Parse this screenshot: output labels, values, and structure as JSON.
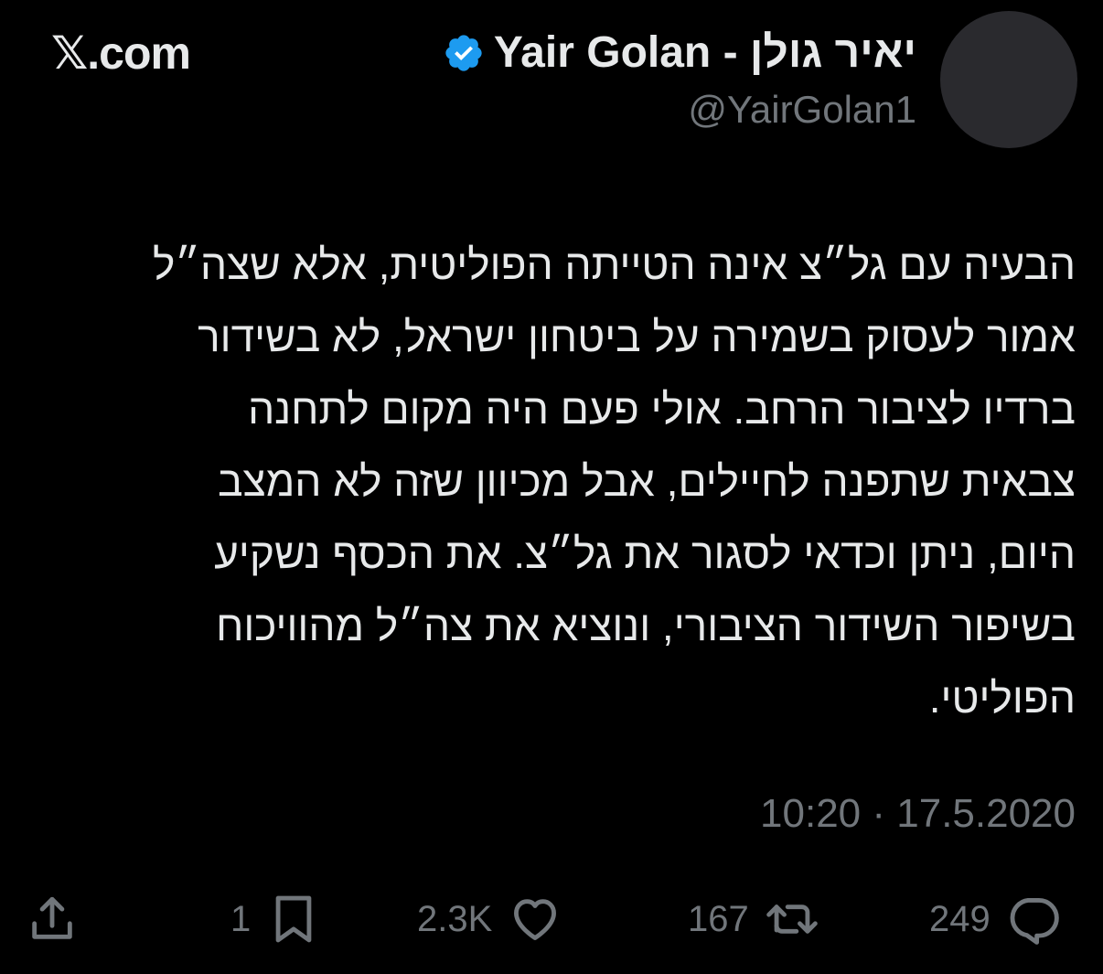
{
  "header": {
    "site_label": "𝕏.com",
    "display_name": "Yair Golan - יאיר גולן",
    "handle": "@YairGolan1"
  },
  "tweet": {
    "lines": [
      "הבעיה עם גל״צ אינה הטייתה הפוליטית, אלא שצה״ל",
      "אמור לעסוק בשמירה על ביטחון ישראל, לא בשידור",
      "ברדיו לציבור הרחב. אולי פעם היה מקום לתחנה",
      "צבאית שתפנה לחיילים, אבל מכיוון שזה לא המצב",
      "היום, ניתן וכדאי לסגור את גל״צ. את הכסף נשקיע",
      "בשיפור השידור הציבורי, ונוציא את צה״ל מהוויכוח",
      "הפוליטי."
    ],
    "timestamp": "10:20 · 17.5.2020"
  },
  "actions": {
    "reply_count": "249",
    "retweet_count": "167",
    "like_count": "2.3K",
    "bookmark_count": "1"
  },
  "icons": {
    "verified": "verified-badge-icon",
    "reply": "reply-icon",
    "retweet": "retweet-icon",
    "like": "heart-icon",
    "bookmark": "bookmark-icon",
    "share": "share-icon"
  },
  "colors": {
    "background": "#000000",
    "text": "#e7e9ea",
    "muted": "#71767b",
    "verified_blue": "#1d9bf0"
  }
}
